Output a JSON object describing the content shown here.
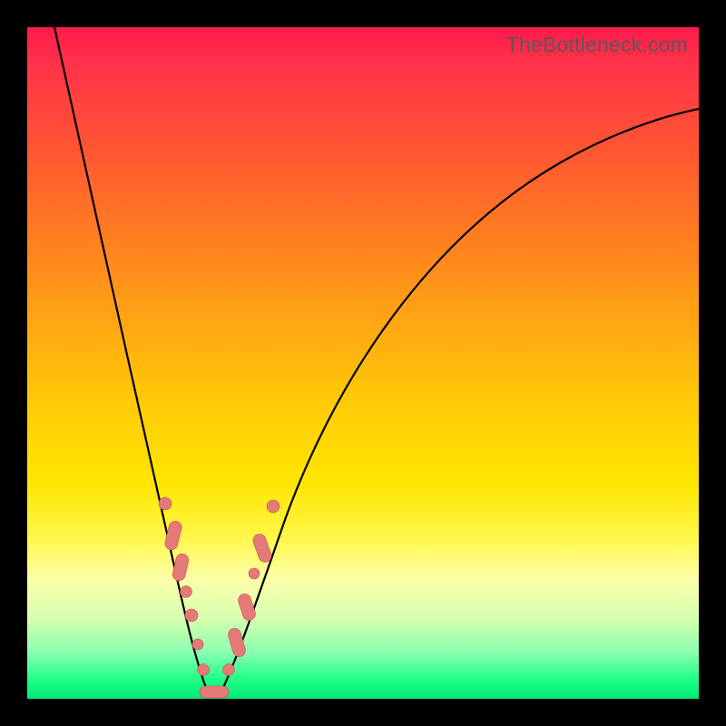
{
  "watermark": "TheBottleneck.com",
  "colors": {
    "background": "#000000",
    "gradient_top": "#ff1a4d",
    "gradient_bottom": "#00e878",
    "curve": "#000000",
    "bead_fill": "#e47a77",
    "bead_stroke": "#c95350"
  },
  "chart_data": {
    "type": "line",
    "title": "",
    "xlabel": "",
    "ylabel": "",
    "xlim": [
      0,
      100
    ],
    "ylim": [
      0,
      100
    ],
    "grid": false,
    "legend": false,
    "notes": "V-shaped bottleneck curve; y is bottleneck percentage (0 at trough). Background heat gradient maps y: green≈0 → yellow≈50 → red≈100. Axes unlabeled; values estimated from pixel positions.",
    "series": [
      {
        "name": "bottleneck-curve",
        "x": [
          4,
          8,
          12,
          16,
          19,
          22,
          24,
          26,
          27,
          28,
          30,
          33,
          37,
          42,
          50,
          60,
          72,
          86,
          100
        ],
        "y": [
          100,
          83,
          66,
          49,
          35,
          22,
          12,
          4,
          0,
          0,
          4,
          12,
          24,
          36,
          50,
          62,
          73,
          82,
          88
        ]
      }
    ],
    "markers": {
      "description": "Salmon beads/pills clustered near the trough on both branches where y ≲ 30.",
      "points": [
        {
          "x": 20.5,
          "y": 29,
          "shape": "circle"
        },
        {
          "x": 21.8,
          "y": 23,
          "shape": "pill"
        },
        {
          "x": 22.8,
          "y": 18,
          "shape": "pill"
        },
        {
          "x": 23.6,
          "y": 13,
          "shape": "circle"
        },
        {
          "x": 24.4,
          "y": 9,
          "shape": "circle"
        },
        {
          "x": 25.2,
          "y": 5,
          "shape": "circle"
        },
        {
          "x": 27.0,
          "y": 0.5,
          "shape": "pill-horizontal"
        },
        {
          "x": 28.5,
          "y": 0.5,
          "shape": "pill-horizontal"
        },
        {
          "x": 30.2,
          "y": 4,
          "shape": "circle"
        },
        {
          "x": 31.6,
          "y": 9,
          "shape": "pill"
        },
        {
          "x": 32.8,
          "y": 14,
          "shape": "pill"
        },
        {
          "x": 34.2,
          "y": 20,
          "shape": "circle"
        },
        {
          "x": 35.4,
          "y": 24,
          "shape": "pill"
        },
        {
          "x": 36.6,
          "y": 29,
          "shape": "circle"
        }
      ]
    }
  }
}
